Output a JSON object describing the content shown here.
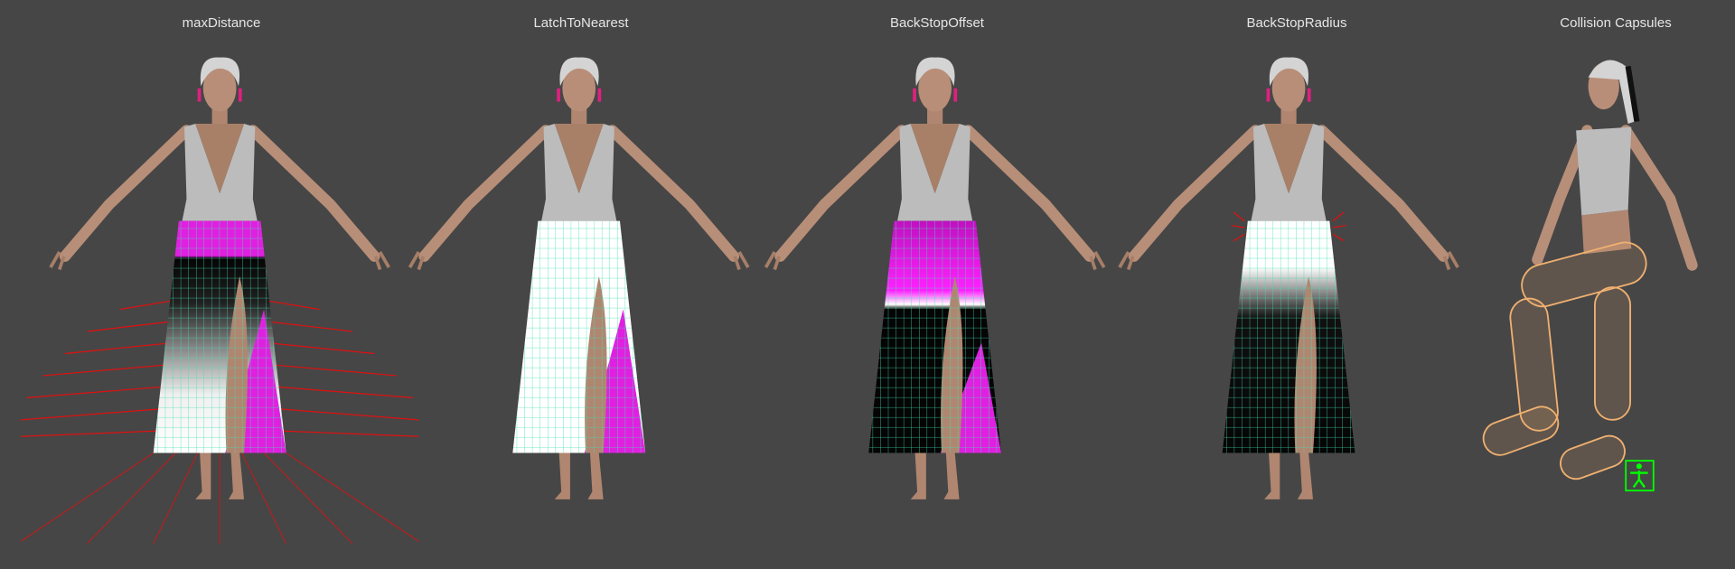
{
  "panels": [
    {
      "title": "maxDistance"
    },
    {
      "title": "LatchToNearest"
    },
    {
      "title": "BackStopOffset"
    },
    {
      "title": "BackStopRadius"
    },
    {
      "title": "Collision Capsules"
    }
  ],
  "colors": {
    "background": "#464646",
    "paint_max": "#ff00ff",
    "paint_min": "#000000",
    "paint_mid": "#ffffff",
    "grid": "#40e0b0",
    "maxdistance_lines": "#e01010",
    "capsules": "#f0b070",
    "gizmo": "#00ff00"
  }
}
